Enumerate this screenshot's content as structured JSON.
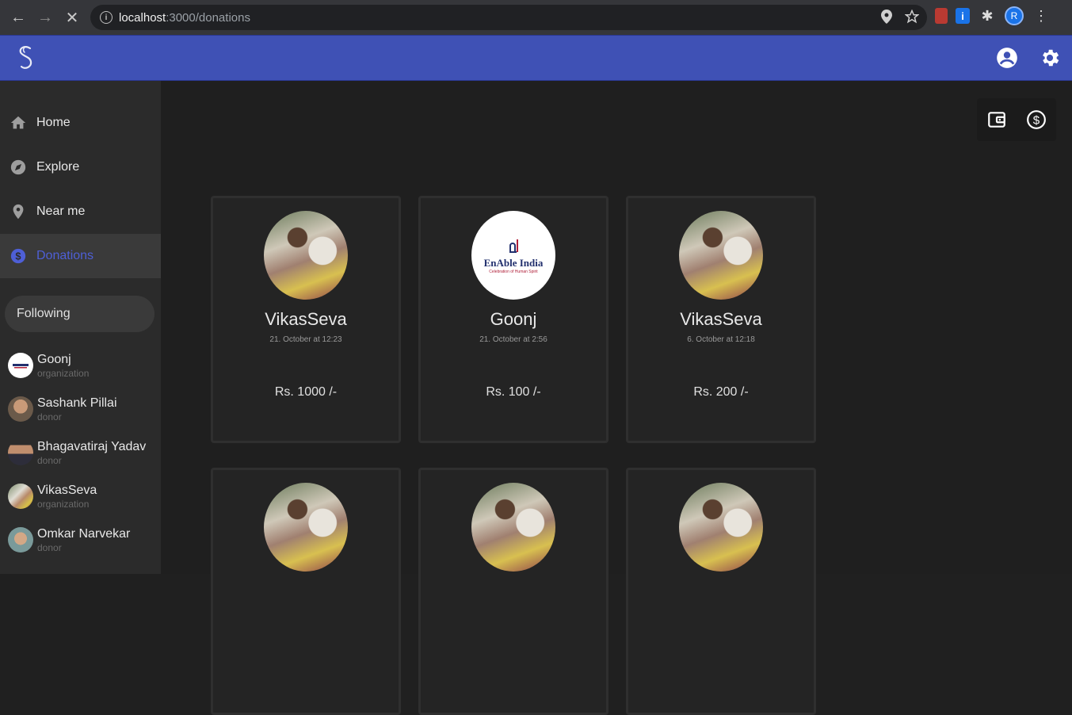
{
  "browser": {
    "url_host": "localhost",
    "url_path": ":3000/donations",
    "profile_initial": "R",
    "ext_info": "i"
  },
  "sidebar": {
    "nav": [
      {
        "label": "Home",
        "icon": "home-icon"
      },
      {
        "label": "Explore",
        "icon": "compass-icon"
      },
      {
        "label": "Near me",
        "icon": "location-pin-icon"
      },
      {
        "label": "Donations",
        "icon": "dollar-circle-icon",
        "active": true
      }
    ],
    "following_label": "Following",
    "following": [
      {
        "name": "Goonj",
        "role": "organization"
      },
      {
        "name": "Sashank Pillai",
        "role": "donor"
      },
      {
        "name": "Bhagavatiraj Yadav",
        "role": "donor"
      },
      {
        "name": "VikasSeva",
        "role": "organization"
      },
      {
        "name": "Omkar Narvekar",
        "role": "donor"
      }
    ]
  },
  "cards": [
    {
      "name": "VikasSeva",
      "date": "21. October at 12:23",
      "amount": "Rs. 1000 /-",
      "image": "vikasseva-photo"
    },
    {
      "name": "Goonj",
      "date": "21. October at 2:56",
      "amount": "Rs. 100 /-",
      "image": "enable-india-logo",
      "logo_title": "EnAble India",
      "logo_subtitle": "Celebration of Human Spirit"
    },
    {
      "name": "VikasSeva",
      "date": "6. October at 12:18",
      "amount": "Rs. 200 /-",
      "image": "vikasseva-photo"
    }
  ],
  "colors": {
    "app_bar": "#3f51b5",
    "active_accent": "#4e5fd6",
    "background": "#1f1f1f"
  }
}
